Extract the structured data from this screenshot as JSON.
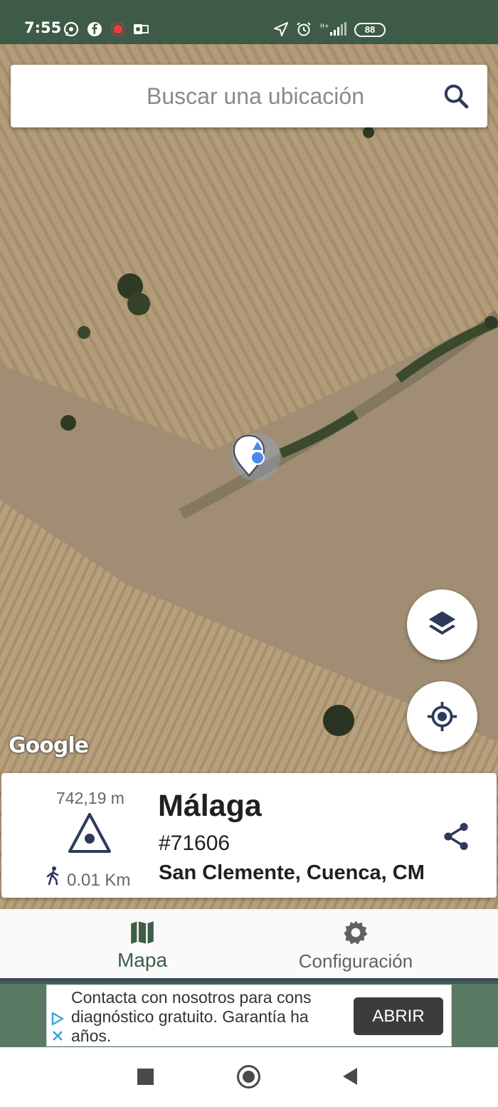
{
  "status_bar": {
    "time": "7:55",
    "battery": "88",
    "notification_icons": [
      "whatsapp-icon",
      "facebook-icon",
      "record-icon",
      "outlook-icon"
    ],
    "system_icons": [
      "location-arrow-icon",
      "alarm-icon",
      "signal-icon"
    ]
  },
  "search": {
    "placeholder": "Buscar una ubicación"
  },
  "map": {
    "attribution": "Google",
    "buttons": [
      "layers-icon",
      "my-location-icon"
    ]
  },
  "place_card": {
    "elevation": "742,19 m",
    "distance": "0.01 Km",
    "name": "Málaga",
    "code": "#71606",
    "region": "San Clemente, Cuenca, CM"
  },
  "bottom_nav": {
    "items": [
      {
        "label": "Mapa",
        "icon": "map-icon",
        "active": true
      },
      {
        "label": "Configuración",
        "icon": "gear-icon",
        "active": false
      }
    ]
  },
  "ad": {
    "text_lines": [
      "Contacta con nosotros para cons",
      "diagnóstico gratuito. Garantía ha",
      "años."
    ],
    "button": "ABRIR"
  },
  "colors": {
    "accent": "#3e5e47",
    "primary_dark": "#2d3a5a",
    "status_bar": "#3d5b47"
  }
}
